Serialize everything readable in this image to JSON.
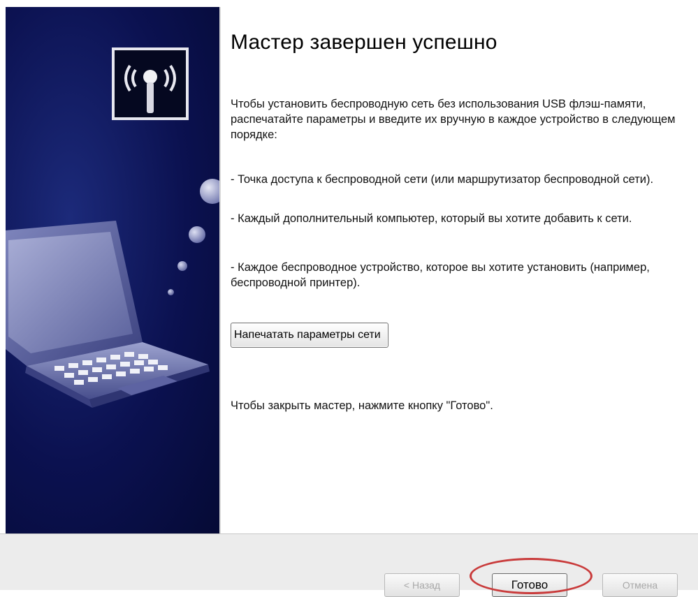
{
  "wizard": {
    "title": "Мастер завершен успешно",
    "intro": "Чтобы установить беспроводную сеть без использования USB флэш-памяти, распечатайте параметры и введите их вручную в каждое устройство в следующем порядке:",
    "steps": [
      "- Точка доступа к беспроводной сети (или маршрутизатор беспроводной сети).",
      "- Каждый дополнительный компьютер, который вы хотите добавить к сети.",
      "- Каждое беспроводное устройство, которое вы хотите установить (например, беспроводной принтер)."
    ],
    "print_button": "Напечатать параметры сети",
    "close_hint": "Чтобы закрыть мастер, нажмите кнопку \"Готово\"."
  },
  "footer": {
    "back_label": "< Назад",
    "done_label": "Готово",
    "cancel_label": "Отмена"
  },
  "icons": {
    "side_badge": "wireless-antenna-icon",
    "illustration": "laptop-icon"
  },
  "colors": {
    "side_panel": "#0b1150",
    "annotation": "#c93b3b",
    "footer_bg": "#ececec"
  }
}
